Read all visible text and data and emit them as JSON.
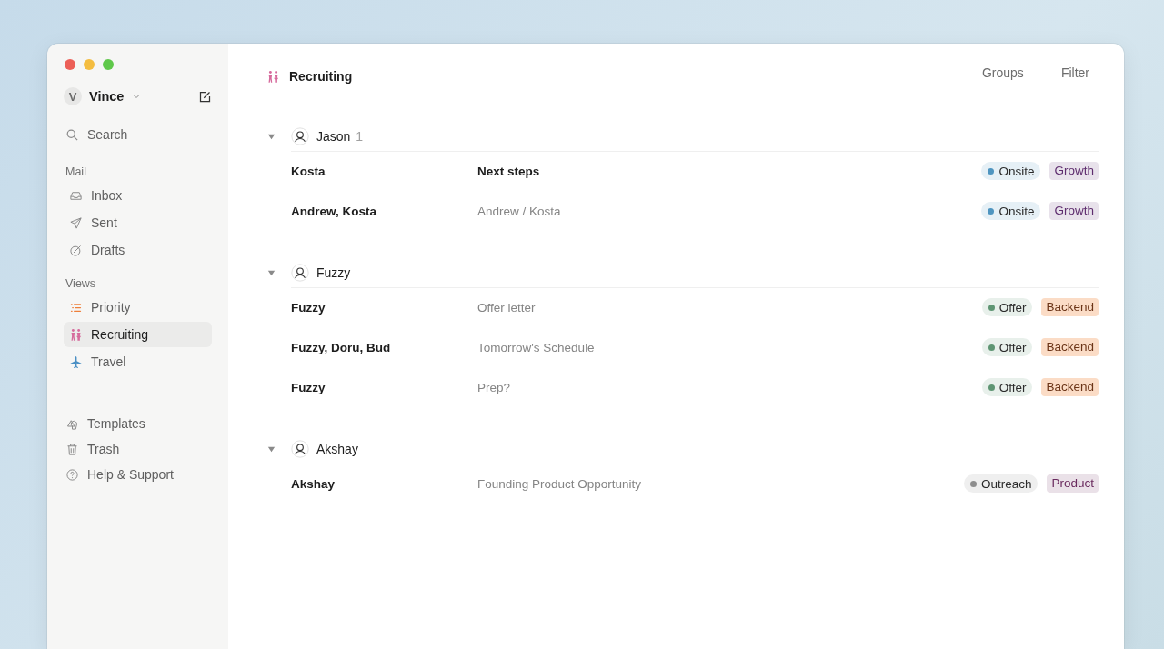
{
  "account": {
    "initial": "V",
    "name": "Vince"
  },
  "search": {
    "label": "Search"
  },
  "sidebar": {
    "sections": [
      {
        "title": "Mail",
        "items": [
          {
            "label": "Inbox",
            "selected": false
          },
          {
            "label": "Sent",
            "selected": false
          },
          {
            "label": "Drafts",
            "selected": false
          }
        ]
      },
      {
        "title": "Views",
        "items": [
          {
            "label": "Priority",
            "selected": false
          },
          {
            "label": "Recruiting",
            "selected": true
          },
          {
            "label": "Travel",
            "selected": false
          }
        ]
      }
    ],
    "footer_items": [
      {
        "label": "Templates"
      },
      {
        "label": "Trash"
      },
      {
        "label": "Help & Support"
      }
    ]
  },
  "header": {
    "title": "Recruiting",
    "actions": [
      "Groups",
      "Filter"
    ]
  },
  "groups": [
    {
      "name": "Jason",
      "count": "1",
      "expanded": true,
      "rows": [
        {
          "from": "Kosta",
          "subject": "Next steps",
          "unread": true,
          "status": {
            "label": "Onsite",
            "color": "#4f95c0"
          },
          "tag": {
            "label": "Growth",
            "color": "#5e2d6e"
          }
        },
        {
          "from": "Andrew, Kosta",
          "subject": "Andrew / Kosta",
          "unread": false,
          "status": {
            "label": "Onsite",
            "color": "#4f95c0"
          },
          "tag": {
            "label": "Growth",
            "color": "#5e2d6e"
          }
        }
      ]
    },
    {
      "name": "Fuzzy",
      "expanded": true,
      "rows": [
        {
          "from": "Fuzzy",
          "subject": "Offer letter",
          "unread": false,
          "status": {
            "label": "Offer",
            "color": "#5e9573"
          },
          "tag": {
            "label": "Backend",
            "color": "#6b3417"
          }
        },
        {
          "from": "Fuzzy, Doru, Bud",
          "subject": "Tomorrow's Schedule",
          "unread": false,
          "status": {
            "label": "Offer",
            "color": "#5e9573"
          },
          "tag": {
            "label": "Backend",
            "color": "#6b3417"
          }
        },
        {
          "from": "Fuzzy",
          "subject": "Prep?",
          "unread": false,
          "status": {
            "label": "Offer",
            "color": "#5e9573"
          },
          "tag": {
            "label": "Backend",
            "color": "#6b3417"
          }
        }
      ]
    },
    {
      "name": "Akshay",
      "expanded": true,
      "rows": [
        {
          "from": "Akshay",
          "subject": "Founding Product Opportunity",
          "unread": false,
          "status": {
            "label": "Outreach",
            "color": "#8e8e8e"
          },
          "tag": {
            "label": "Product",
            "color": "#6a2a5e"
          }
        }
      ]
    }
  ]
}
